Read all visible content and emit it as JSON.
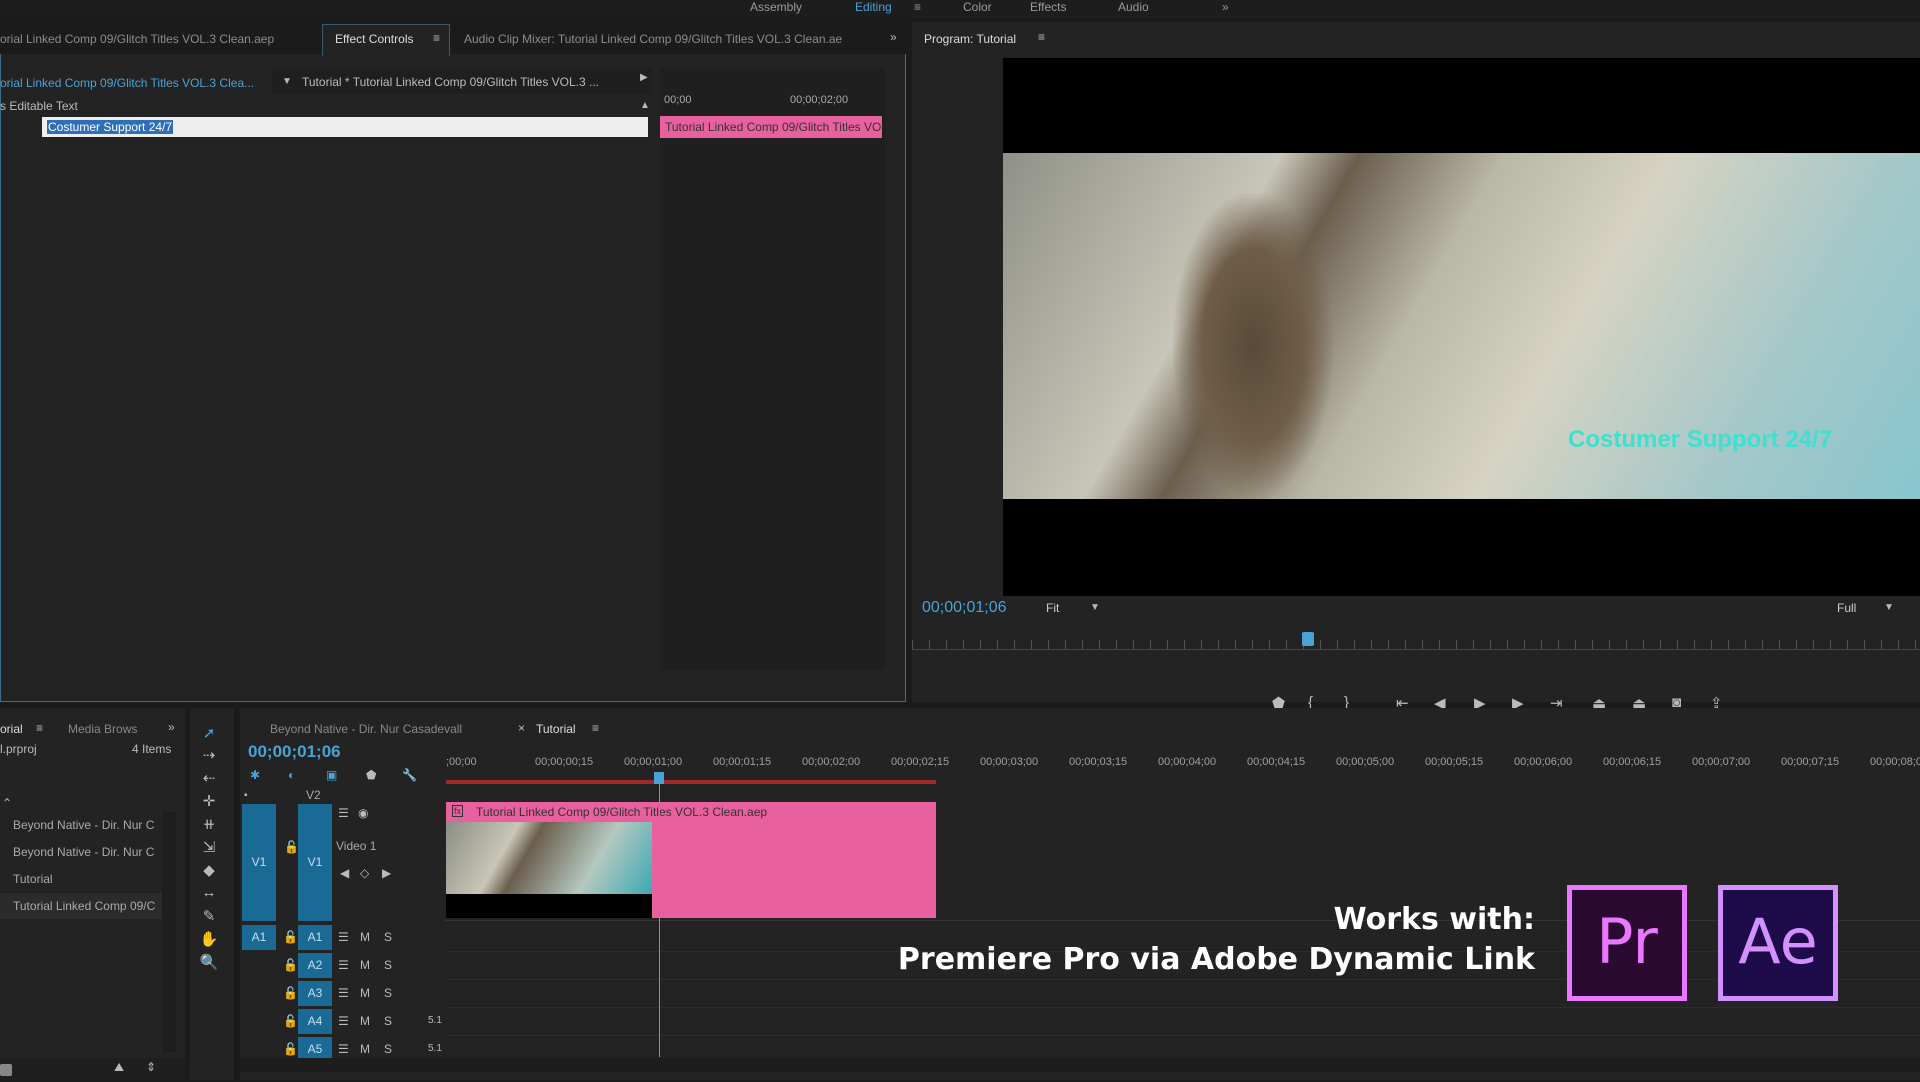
{
  "workspaces": [
    "Assembly",
    "Editing",
    "Color",
    "Effects",
    "Audio"
  ],
  "active_workspace": "Editing",
  "top_panel": {
    "tabs": [
      "orial Linked Comp 09/Glitch Titles VOL.3 Clean.aep",
      "Effect Controls",
      "Audio Clip Mixer: Tutorial Linked Comp 09/Glitch Titles VOL.3 Clean.ae"
    ],
    "master_clip": "orial Linked Comp 09/Glitch Titles VOL.3 Clea...",
    "sequence_clip": "Tutorial * Tutorial Linked Comp 09/Glitch Titles VOL.3 ...",
    "property_label": "s Editable Text",
    "text_value": "Costumer Support 24/7",
    "ruler": [
      "00;00",
      "00;00;02;00"
    ],
    "clip_label": "Tutorial Linked Comp 09/Glitch Titles VOL.3 Clean.aep"
  },
  "program": {
    "title": "Program: Tutorial",
    "overlay_text": "Costumer Support 24/7",
    "timecode": "00;00;01;06",
    "zoom": "Fit",
    "resolution": "Full",
    "playhead_fraction": 0.5
  },
  "project": {
    "tabs": [
      "orial",
      "Media Brows"
    ],
    "file": "l.prproj",
    "count": "4 Items",
    "items": [
      "Beyond Native - Dir. Nur C",
      "Beyond Native - Dir. Nur C",
      "Tutorial",
      "Tutorial Linked Comp 09/C"
    ]
  },
  "timeline": {
    "tabs": [
      "Beyond Native - Dir. Nur Casadevall",
      "Tutorial"
    ],
    "timecode": "00;00;01;06",
    "ruler": [
      ";00;00",
      "00;00;00;15",
      "00;00;01;00",
      "00;00;01;15",
      "00;00;02;00",
      "00;00;02;15",
      "00;00;03;00",
      "00;00;03;15",
      "00;00;04;00",
      "00;00;04;15",
      "00;00;05;00",
      "00;00;05;15",
      "00;00;06;00",
      "00;00;06;15",
      "00;00;07;00",
      "00;00;07;15",
      "00;00;08;00"
    ],
    "video_tracks": [
      {
        "src": "",
        "name": "V2"
      },
      {
        "src": "V1",
        "name": "V1",
        "label": "Video 1"
      }
    ],
    "audio_tracks": [
      {
        "src": "A1",
        "name": "A1"
      },
      {
        "name": "A2"
      },
      {
        "name": "A3"
      },
      {
        "name": "A4",
        "ch": "5.1"
      },
      {
        "name": "A5",
        "ch": "5.1"
      }
    ],
    "mute": "M",
    "solo": "S",
    "clip": "Tutorial Linked Comp 09/Glitch Titles VOL.3 Clean.aep"
  },
  "promo": {
    "line1": "Works with:",
    "line2": "Premiere Pro via Adobe Dynamic Link",
    "pr_logo": "Pr",
    "ae_logo": "Ae"
  },
  "colors": {
    "accent": "#2d8ceb",
    "clip_pink": "#e8609e",
    "timecode": "#4aa3d6",
    "overlay_text": "#3ee0d0",
    "pr": "#ea77ff",
    "ae": "#d291ff"
  }
}
